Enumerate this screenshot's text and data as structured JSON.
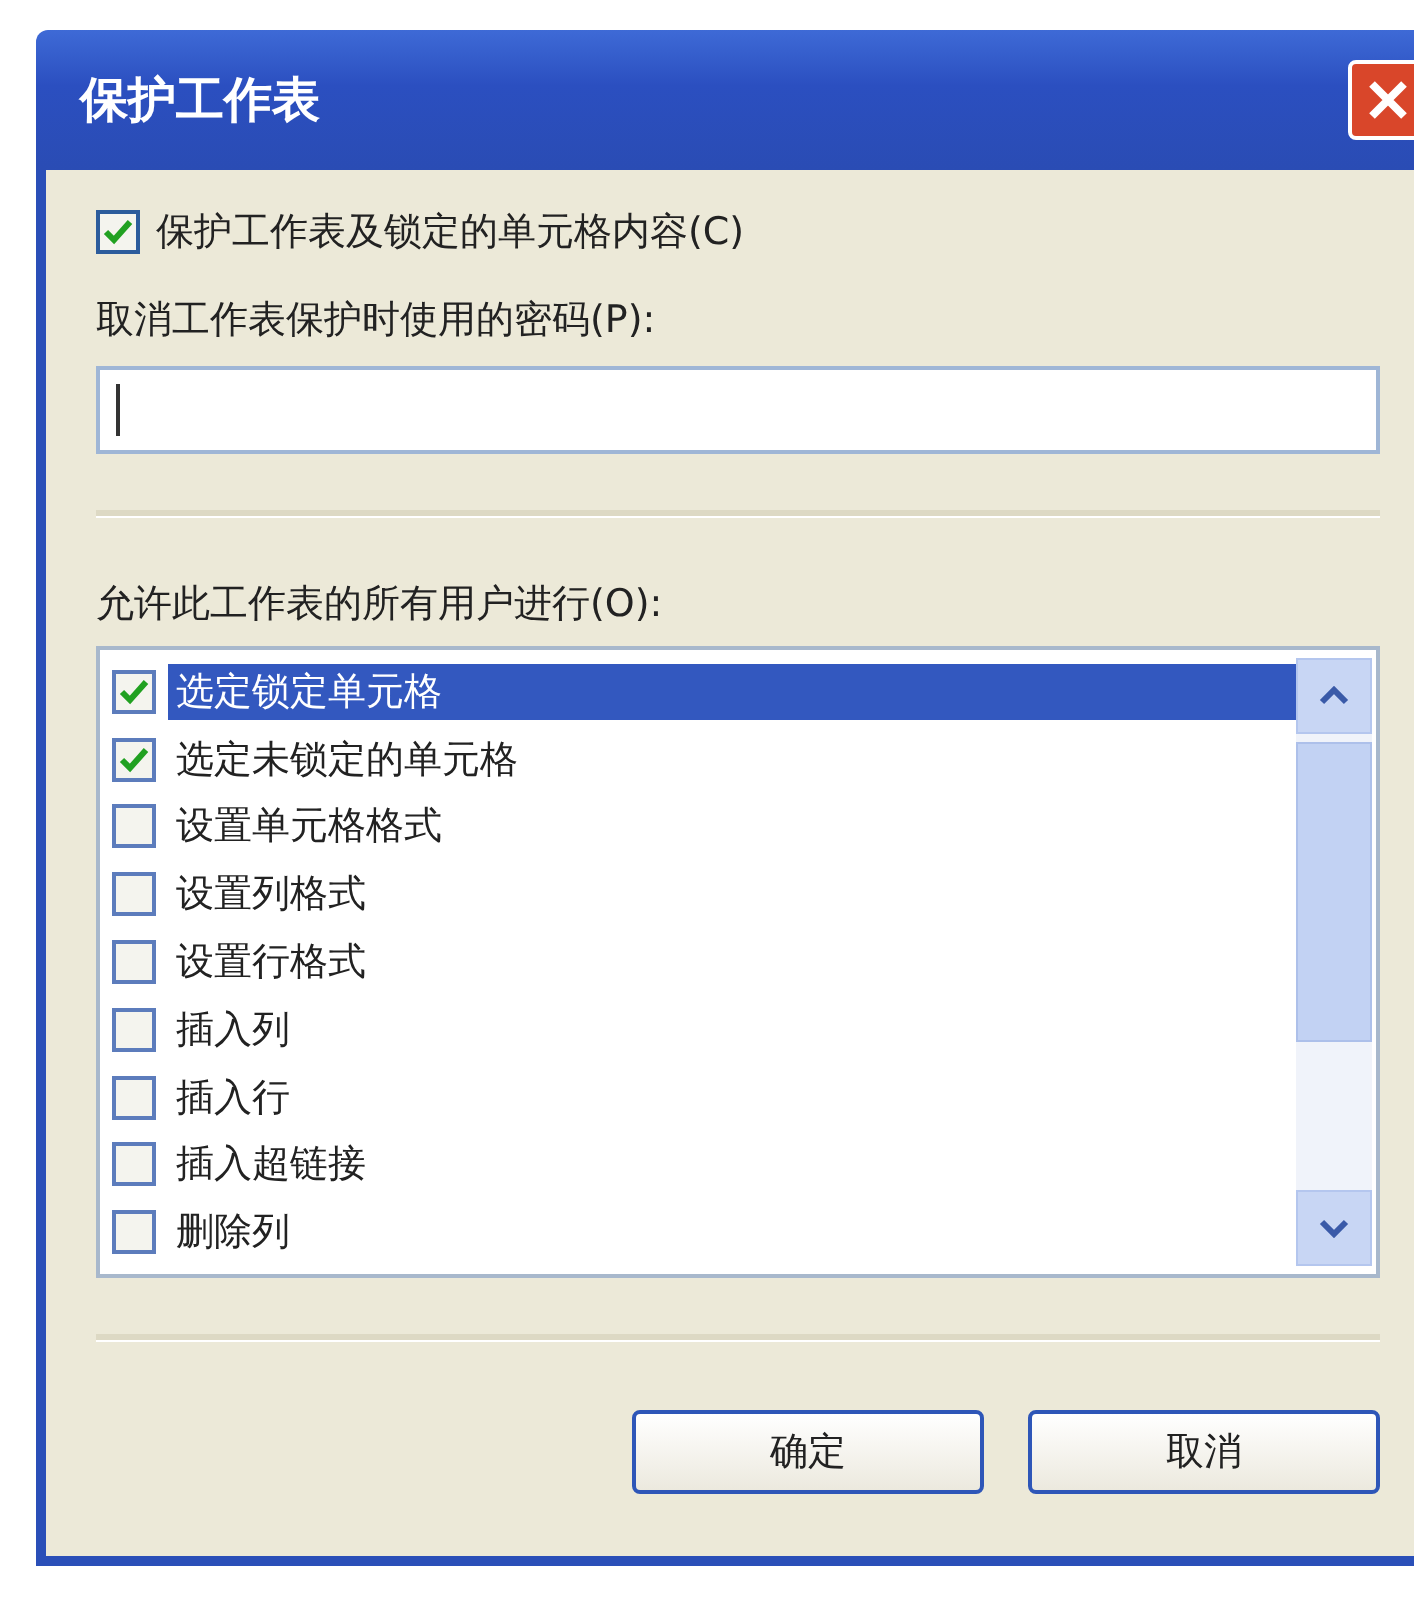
{
  "window": {
    "title": "保护工作表"
  },
  "protect_checkbox": {
    "label": "保护工作表及锁定的单元格内容(C)",
    "checked": true
  },
  "password": {
    "label": "取消工作表保护时使用的密码(P):"
  },
  "permissions": {
    "label": "允许此工作表的所有用户进行(O):",
    "items": [
      {
        "label": "选定锁定单元格",
        "checked": true,
        "selected": true
      },
      {
        "label": "选定未锁定的单元格",
        "checked": true,
        "selected": false
      },
      {
        "label": "设置单元格格式",
        "checked": false,
        "selected": false
      },
      {
        "label": "设置列格式",
        "checked": false,
        "selected": false
      },
      {
        "label": "设置行格式",
        "checked": false,
        "selected": false
      },
      {
        "label": "插入列",
        "checked": false,
        "selected": false
      },
      {
        "label": "插入行",
        "checked": false,
        "selected": false
      },
      {
        "label": "插入超链接",
        "checked": false,
        "selected": false
      },
      {
        "label": "删除列",
        "checked": false,
        "selected": false
      }
    ]
  },
  "buttons": [
    "确定",
    "取消"
  ]
}
